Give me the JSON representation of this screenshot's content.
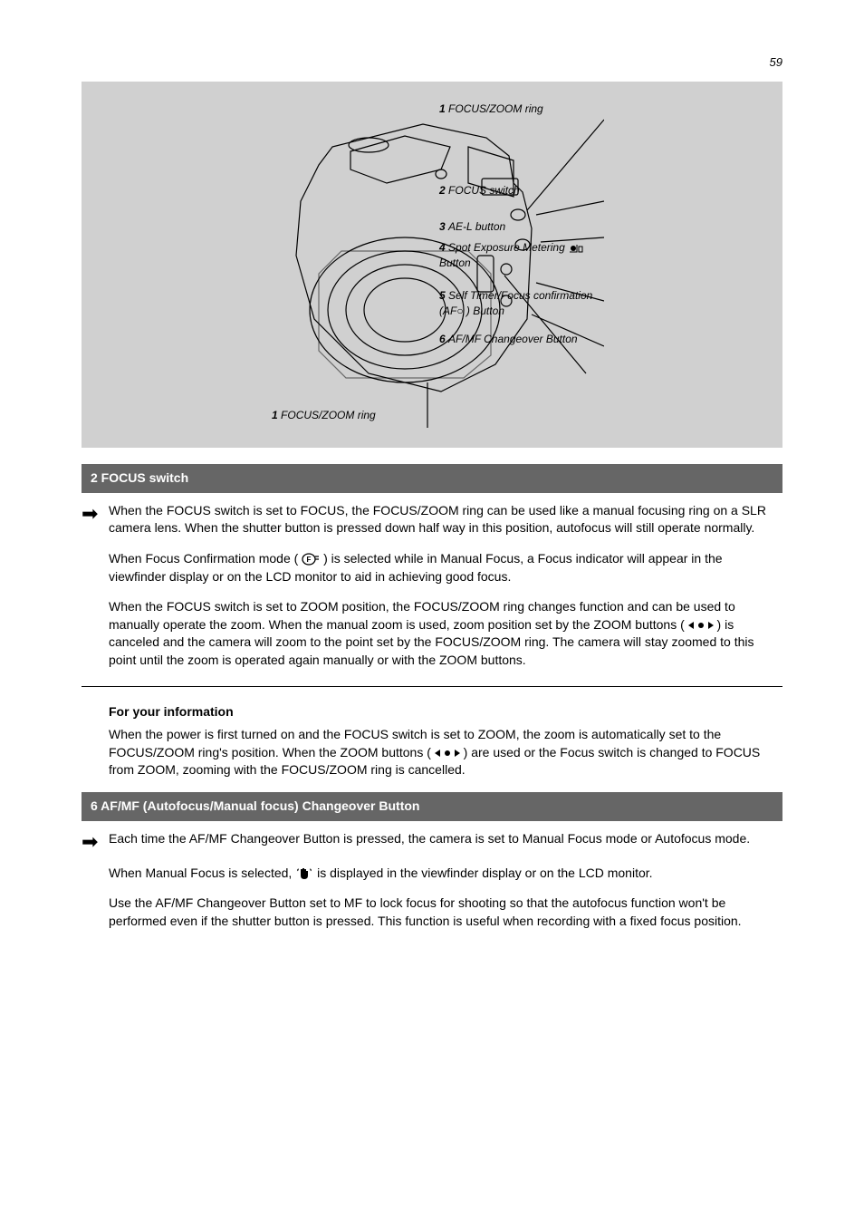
{
  "page_number_label": "59",
  "callouts": {
    "c1": {
      "num": "1",
      "label": "FOCUS/ZOOM ring"
    },
    "c2": {
      "num": "2",
      "label": "FOCUS switch"
    },
    "c3": {
      "num": "3",
      "label": "AE-L button"
    },
    "c4": {
      "num": "4",
      "label": "Spot Exposure Metering",
      "sub": "Button"
    },
    "c5": {
      "num": "5",
      "label": "Self Timer/Focus confirmation",
      "sub": "(AF○ ) Button"
    },
    "c6": {
      "num": "6",
      "label": "AF/MF Changeover Button"
    }
  },
  "section1_title": "2 FOCUS switch",
  "section1_para1": "When the FOCUS switch is set to FOCUS, the FOCUS/ZOOM ring can be used like a manual focusing ring on a SLR camera lens. When the shutter button is pressed down half way in this position, autofocus will still operate normally.",
  "section1_para2_a": "When Focus Confirmation mode (",
  "section1_para2_b": ") is selected while in Manual Focus, a Focus indicator will appear in the viewfinder display or on the LCD monitor to aid in achieving good focus.",
  "section1_para3_a": "When the FOCUS switch is set to ZOOM position, the FOCUS/ZOOM ring changes function and can be used to manually operate the zoom. When the manual zoom is used, zoom position set by the ZOOM buttons (",
  "section1_para3_b": ") is canceled and the camera will zoom to the point set by the FOCUS/ZOOM ring. The camera will stay zoomed to this point until the zoom is operated again manually or with the ZOOM buttons.",
  "info_heading": "For your information",
  "info_body_a": "When the power is first turned on and the FOCUS switch is set to ZOOM, the zoom is automatically set to the FOCUS/ZOOM ring's position. When the ZOOM buttons (",
  "info_body_b": ") are used or the Focus switch is changed to FOCUS from ZOOM, zooming with the FOCUS/ZOOM ring is cancelled.",
  "section2_title": "6 AF/MF (Autofocus/Manual focus) Changeover Button",
  "section2_para1": "Each time the AF/MF Changeover Button is pressed, the camera is set to Manual Focus mode or Autofocus mode.",
  "section2_para2_a": "When Manual Focus is selected,",
  "section2_para2_b": "is displayed in the viewfinder display or on the LCD monitor.",
  "section2_para3": "Use the AF/MF Changeover Button set to MF to lock focus for shooting so that the autofocus function won't be performed even if the shutter button is pressed. This function is useful when recording with a fixed focus position."
}
